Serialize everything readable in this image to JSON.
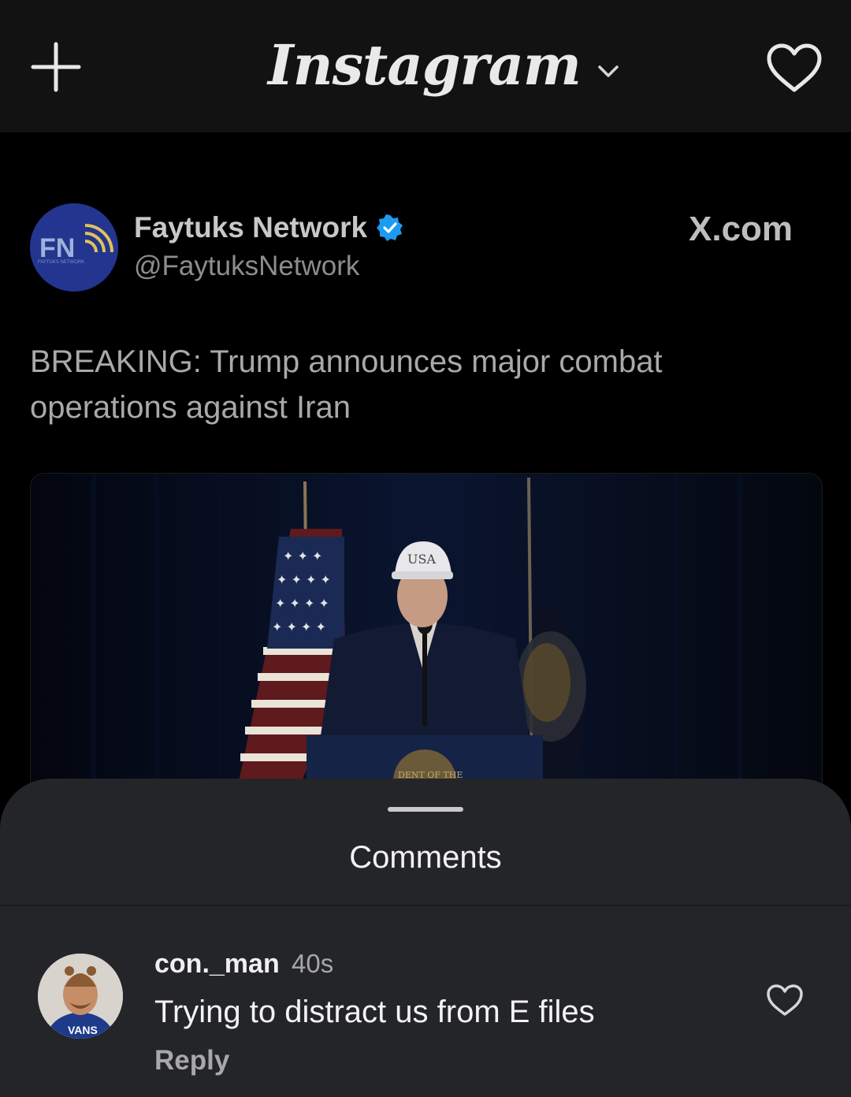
{
  "app_bar": {
    "title": "Instagram",
    "icons": [
      "plus-icon",
      "chevron-down-icon",
      "heart-icon"
    ]
  },
  "post": {
    "author_name": "Faytuks Network",
    "author_handle": "@FaytuksNetwork",
    "source": "X.com",
    "text": "BREAKING: Trump announces major combat operations against Iran",
    "avatar_logo_text": "FN",
    "avatar_tagline": "FAYTUKS NETWORK",
    "media": {
      "cap_text": "USA",
      "seal_text": "DENT OF THE"
    }
  },
  "comments": {
    "title": "Comments",
    "items": [
      {
        "username": "con._man",
        "time": "40s",
        "text": "Trying to distract us from E files",
        "reply_label": "Reply",
        "hoodie_text": "VANS"
      }
    ]
  },
  "colors": {
    "topbar_bg": "#121212",
    "sheet_bg": "#242528",
    "verified": "#1d9bf0",
    "network_blue": "#23358f"
  }
}
